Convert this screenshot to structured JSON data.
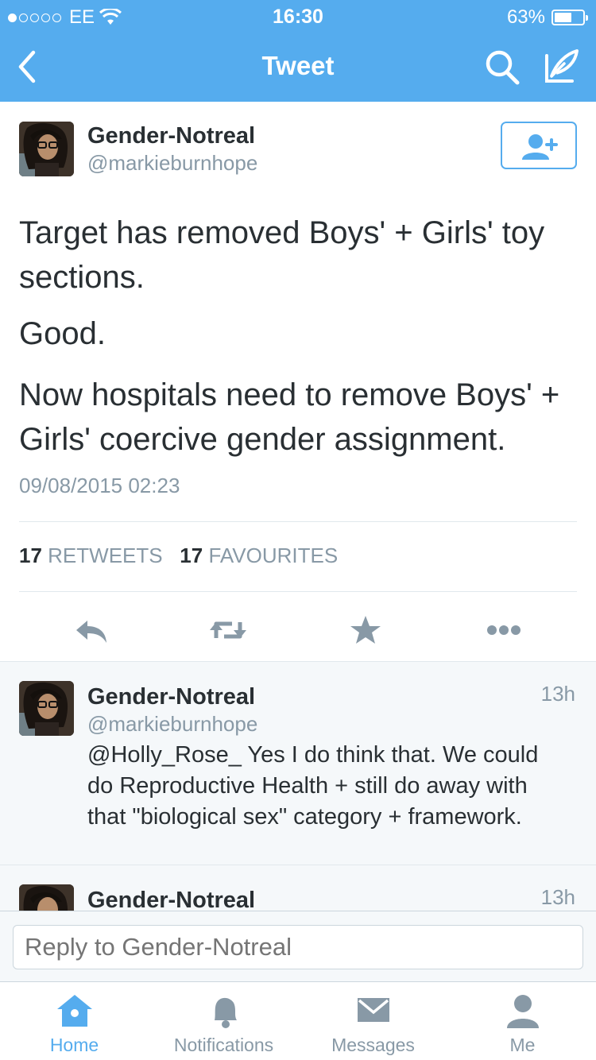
{
  "status_bar": {
    "carrier": "EE",
    "time": "16:30",
    "battery": "63%",
    "battery_level": 0.63
  },
  "nav": {
    "title": "Tweet"
  },
  "tweet": {
    "author_name": "Gender-Notreal",
    "author_handle": "@markieburnhope",
    "paragraphs": [
      "Target has removed Boys' + Girls' toy sections.",
      "Good.",
      "Now hospitals need to remove Boys' + Girls' coercive gender assignment."
    ],
    "timestamp": "09/08/2015 02:23",
    "retweets_count": "17",
    "retweets_label": "RETWEETS",
    "favourites_count": "17",
    "favourites_label": "FAVOURITES"
  },
  "replies": [
    {
      "name": "Gender-Notreal",
      "handle": "@markieburnhope",
      "age": "13h",
      "text": "@Holly_Rose_ Yes I do think that. We could do Reproductive Health + still do away with that \"biological sex\" category + framework."
    },
    {
      "name": "Gender-Notreal",
      "age": "13h"
    }
  ],
  "composer": {
    "placeholder": "Reply to Gender-Notreal"
  },
  "tabs": [
    {
      "label": "Home",
      "icon": "home-icon",
      "active": true
    },
    {
      "label": "Notifications",
      "icon": "bell-icon",
      "active": false
    },
    {
      "label": "Messages",
      "icon": "envelope-icon",
      "active": false
    },
    {
      "label": "Me",
      "icon": "person-icon",
      "active": false
    }
  ],
  "colors": {
    "accent": "#55acee",
    "text": "#292f33",
    "muted": "#8899a6",
    "icon": "#8899a6"
  }
}
